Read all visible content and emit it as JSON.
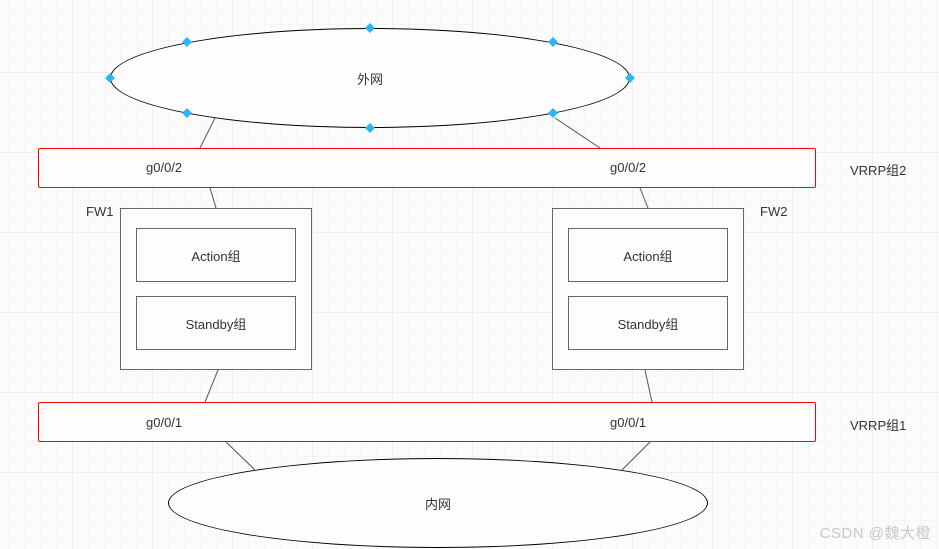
{
  "clouds": {
    "external": "外网",
    "internal": "内网"
  },
  "vrrp": {
    "group2": "VRRP组2",
    "group1": "VRRP组1"
  },
  "interfaces": {
    "g002_left": "g0/0/2",
    "g002_right": "g0/0/2",
    "g001_left": "g0/0/1",
    "g001_right": "g0/0/1"
  },
  "firewalls": {
    "fw1": "FW1",
    "fw2": "FW2",
    "action": "Action组",
    "standby": "Standby组"
  },
  "watermark": "CSDN @魏大橙"
}
